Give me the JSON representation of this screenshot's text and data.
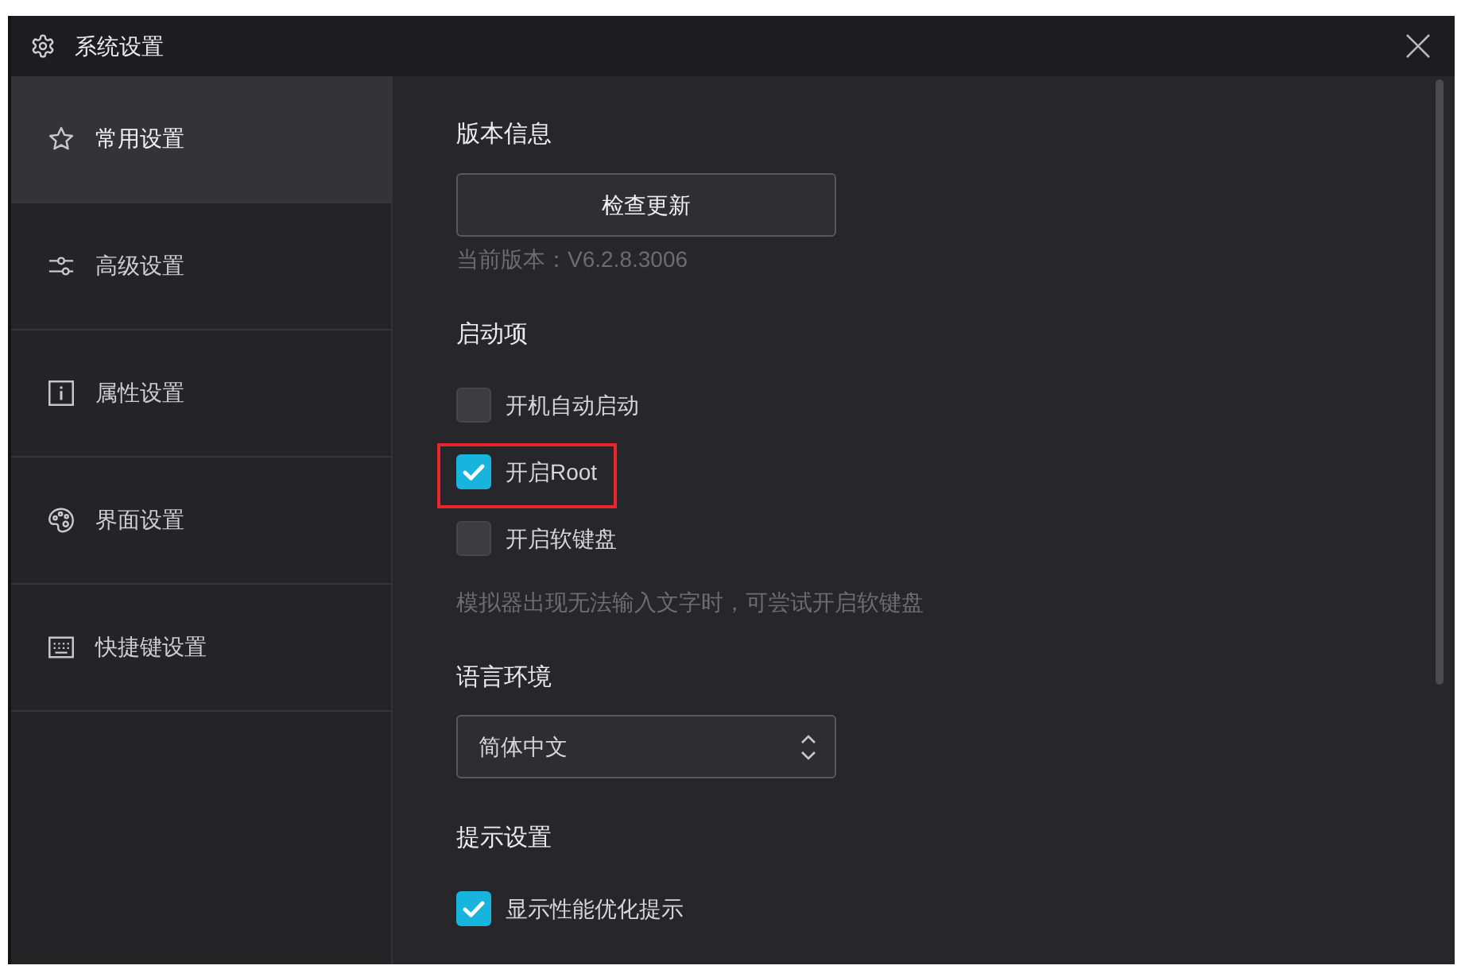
{
  "window": {
    "title": "系统设置"
  },
  "sidebar": {
    "items": [
      {
        "label": "常用设置",
        "selected": true
      },
      {
        "label": "高级设置",
        "selected": false
      },
      {
        "label": "属性设置",
        "selected": false
      },
      {
        "label": "界面设置",
        "selected": false
      },
      {
        "label": "快捷键设置",
        "selected": false
      }
    ]
  },
  "sections": [
    {
      "title": "版本信息",
      "button": {
        "label": "检查更新"
      },
      "note": "当前版本：V6.2.8.3006"
    },
    {
      "title": "启动项",
      "options": [
        {
          "label": "开机自动启动",
          "checked": false,
          "highlighted": false
        },
        {
          "label": "开启Root",
          "checked": true,
          "highlighted": true
        },
        {
          "label": "开启软键盘",
          "checked": false,
          "highlighted": false
        }
      ],
      "note": "模拟器出现无法输入文字时，可尝试开启软键盘"
    },
    {
      "title": "语言环境",
      "select": {
        "value": "简体中文"
      }
    },
    {
      "title": "提示设置",
      "options": [
        {
          "label": "显示性能优化提示",
          "checked": true,
          "highlighted": false
        }
      ]
    }
  ]
}
